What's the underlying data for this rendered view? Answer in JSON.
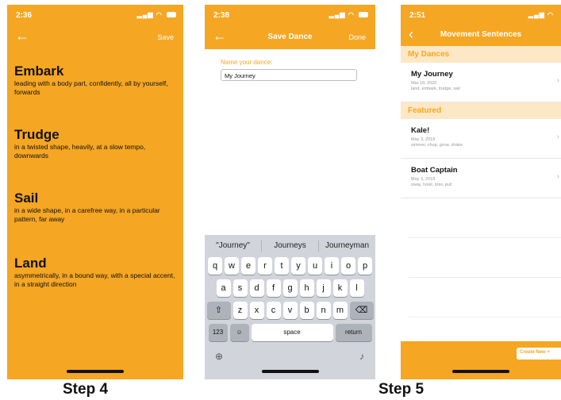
{
  "phone1": {
    "time": "2:36",
    "save_label": "Save",
    "entries": [
      {
        "word": "Embark",
        "desc": "leading with a body part, confidently, all by yourself, forwards"
      },
      {
        "word": "Trudge",
        "desc": "in a twisted shape, heavily, at a slow tempo, downwards"
      },
      {
        "word": "Sail",
        "desc": "in a wide shape, in a carefree way, in a particular pattern, far away"
      },
      {
        "word": "Land",
        "desc": "asymmetrically, in a bound way, with a special accent, in a straight direction"
      }
    ]
  },
  "phone2": {
    "time": "2:38",
    "title": "Save Dance",
    "done_label": "Done",
    "name_label": "Name your dance:",
    "name_value": "My Journey",
    "suggestions": [
      "\"Journey\"",
      "Journeys",
      "Journeyman"
    ],
    "rows": [
      [
        "q",
        "w",
        "e",
        "r",
        "t",
        "y",
        "u",
        "i",
        "o",
        "p"
      ],
      [
        "a",
        "s",
        "d",
        "f",
        "g",
        "h",
        "j",
        "k",
        "l"
      ],
      [
        "z",
        "x",
        "c",
        "v",
        "b",
        "n",
        "m"
      ]
    ],
    "num_key": "123",
    "space_key": "space",
    "return_key": "return"
  },
  "phone3": {
    "time": "2:51",
    "title": "Movement Sentences",
    "my_dances_header": "My Dances",
    "my_dances": [
      {
        "name": "My Journey",
        "date": "Mar 18, 2020",
        "moves": "land, embark, trudge, sail"
      }
    ],
    "featured_header": "Featured",
    "featured": [
      {
        "name": "Kale!",
        "date": "May 3, 2018",
        "moves": "simmer, chop, grow, shake"
      },
      {
        "name": "Boat Captain",
        "date": "May 3, 2018",
        "moves": "sway, hoist, toss, pull"
      }
    ],
    "create_new_label": "Create New"
  },
  "captions": {
    "step4": "Step 4",
    "step5": "Step 5"
  },
  "colors": {
    "accent": "#f5a623",
    "section_bg": "#fde8c5",
    "keyboard_bg": "#d1d4da"
  },
  "icons": [
    "back-arrow-icon",
    "chevron-left-icon",
    "chevron-right-icon",
    "shift-icon",
    "delete-icon",
    "emoji-icon",
    "globe-icon",
    "microphone-icon",
    "plus-icon"
  ]
}
